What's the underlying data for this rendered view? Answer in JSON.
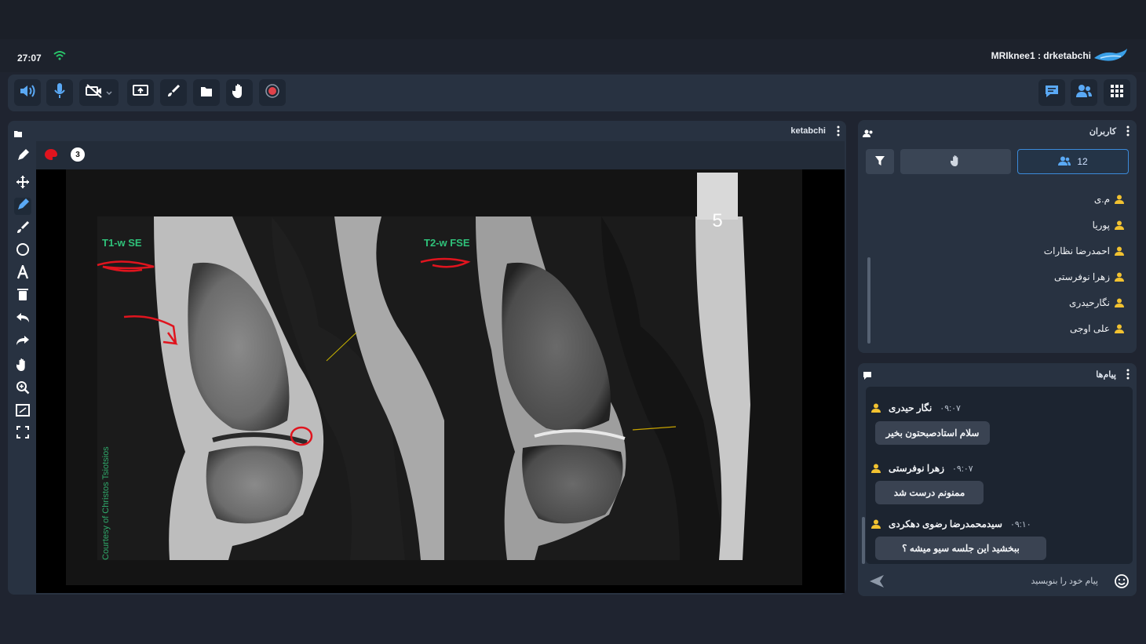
{
  "status": {
    "time": "27:07",
    "session_title": "MRIknee1 : drketabchi"
  },
  "toolbar": {
    "icons": [
      "speaker-icon",
      "microphone-icon",
      "camera-off-icon",
      "share-screen-icon",
      "brush-icon",
      "folder-icon",
      "raise-hand-icon",
      "record-icon",
      "chat-icon",
      "users-icon",
      "apps-grid-icon"
    ]
  },
  "whiteboard": {
    "title": "ketabchi",
    "stroke_size": "3",
    "tools": [
      "pen-icon",
      "move-icon",
      "pencil-icon",
      "brush-icon",
      "circle-icon",
      "text-icon",
      "trash-icon",
      "undo-icon",
      "redo-icon",
      "hand-icon",
      "zoom-icon",
      "fit-icon",
      "fullscreen-icon"
    ],
    "image": {
      "label_left": "T1-w SE",
      "label_right": "T2-w FSE",
      "credit": "Courtesy of Christos Tsiotsios",
      "page_marker": "5"
    },
    "pager": {
      "current": "5"
    }
  },
  "users": {
    "title": "کاربران",
    "count": "12",
    "list": [
      "م.ی",
      "پوریا",
      "احمدرضا نظارات",
      "زهرا نوفرستی",
      "نگارحیدری",
      "علی اوجی"
    ]
  },
  "chat": {
    "title": "پیام‌ها",
    "messages": [
      {
        "name": "نگار حیدری",
        "time": "۰۹:۰۷",
        "text": "سلام استادصبحتون بخیر"
      },
      {
        "name": "زهرا نوفرستی",
        "time": "۰۹:۰۷",
        "text": "ممنونم درست شد"
      },
      {
        "name": "سیدمحمدرضا رضوی دهکردی",
        "time": "۰۹:۱۰",
        "text": "ببخشید این جلسه سیو میشه ؟"
      }
    ],
    "input_placeholder": "پیام خود را بنویسید"
  },
  "colors": {
    "accent": "#3b8ad9",
    "toolbar_blue": "#5aa9f5",
    "annotation_red": "#e0141e",
    "user_yellow": "#f2c230"
  }
}
